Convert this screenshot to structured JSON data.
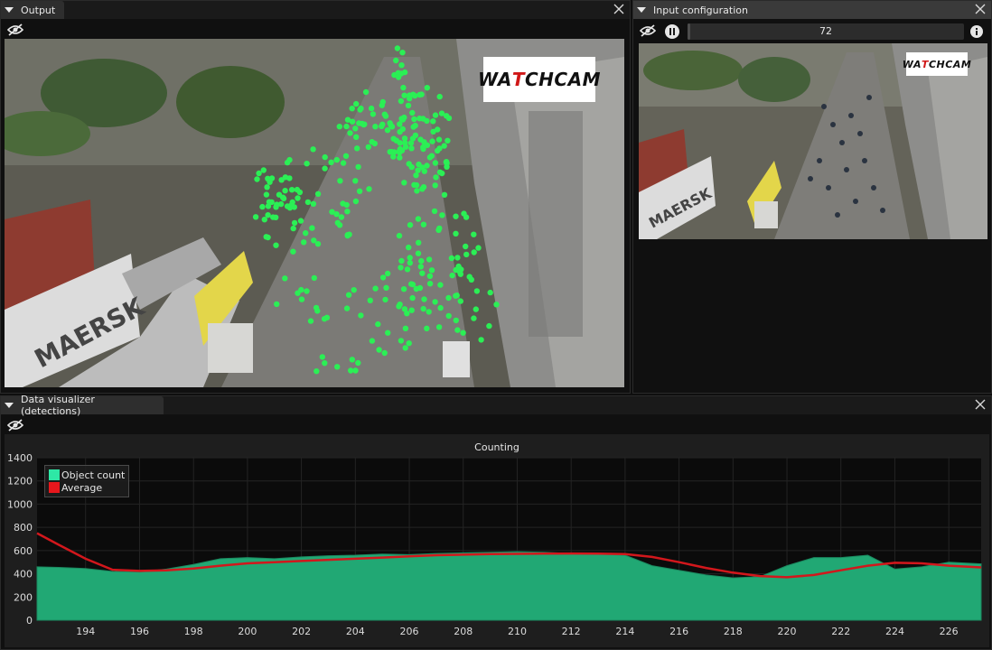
{
  "output_panel": {
    "tab_label": "Output"
  },
  "input_panel": {
    "tab_label": "Input configuration",
    "frame_value": "72",
    "frame_fraction": 0.01
  },
  "visualizer_panel": {
    "tab_label": "Data visualizer (detections)"
  },
  "logo": {
    "text_prefix": "WA",
    "text_red": "T",
    "text_suffix": "CHCAM"
  },
  "icons": [
    "eye-slash-icon",
    "close-icon",
    "pause-icon",
    "info-icon",
    "collapse-triangle-icon"
  ],
  "colors": {
    "detection_dot": "#2bef55",
    "object_count_fill": "#21a874",
    "average_line": "#d2171c",
    "legend_count": "#2ee8a6",
    "legend_avg": "#e8171c"
  },
  "chart_data": {
    "type": "area",
    "title": "Counting",
    "xlabel": "",
    "ylabel": "",
    "xlim": [
      192.2,
      227.2
    ],
    "ylim": [
      0,
      1400
    ],
    "x_ticks": [
      194,
      196,
      198,
      200,
      202,
      204,
      206,
      208,
      210,
      212,
      214,
      216,
      218,
      220,
      222,
      224,
      226
    ],
    "y_ticks": [
      0,
      200,
      400,
      600,
      800,
      1000,
      1200,
      1400
    ],
    "grid": true,
    "legend_position": "top-left",
    "series": [
      {
        "name": "Object count",
        "type": "area",
        "x": [
          192.2,
          193,
          194,
          195,
          196,
          197,
          198,
          199,
          200,
          201,
          202,
          203,
          204,
          205,
          206,
          207,
          208,
          209,
          210,
          211,
          212,
          213,
          214,
          215,
          216,
          217,
          218,
          219,
          220,
          221,
          222,
          223,
          224,
          225,
          226,
          227.2
        ],
        "values": [
          460,
          455,
          445,
          420,
          415,
          440,
          480,
          530,
          540,
          530,
          545,
          555,
          560,
          570,
          565,
          575,
          580,
          585,
          590,
          585,
          575,
          570,
          560,
          470,
          430,
          390,
          365,
          375,
          470,
          540,
          540,
          560,
          440,
          460,
          500,
          485
        ]
      },
      {
        "name": "Average",
        "type": "line",
        "x": [
          192.2,
          193,
          194,
          195,
          196,
          197,
          198,
          199,
          200,
          201,
          202,
          203,
          204,
          205,
          206,
          207,
          208,
          209,
          210,
          211,
          212,
          213,
          214,
          215,
          216,
          217,
          218,
          219,
          220,
          221,
          222,
          223,
          224,
          225,
          226,
          227.2
        ],
        "values": [
          750,
          650,
          530,
          435,
          425,
          430,
          445,
          470,
          490,
          500,
          510,
          520,
          530,
          540,
          550,
          560,
          565,
          570,
          572,
          574,
          575,
          574,
          570,
          545,
          500,
          450,
          410,
          380,
          370,
          390,
          430,
          470,
          495,
          490,
          470,
          455
        ]
      }
    ]
  }
}
